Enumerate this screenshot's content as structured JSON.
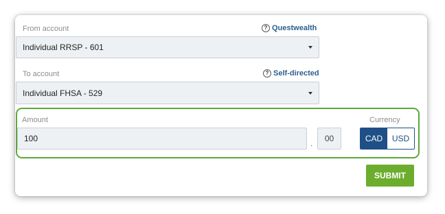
{
  "from_account": {
    "label": "From account",
    "help_text": "Questwealth",
    "help_icon": "question-circle-icon",
    "selected": "Individual RRSP - 601"
  },
  "to_account": {
    "label": "To account",
    "help_text": "Self-directed",
    "help_icon": "question-circle-icon",
    "selected": "Individual FHSA - 529"
  },
  "amount": {
    "label": "Amount",
    "whole_value": "100",
    "decimal_separator": ".",
    "cents_value": "00"
  },
  "currency": {
    "label": "Currency",
    "options": [
      "CAD",
      "USD"
    ],
    "selected": "CAD"
  },
  "submit_label": "SUBMIT",
  "icons": {
    "help": "?"
  },
  "colors": {
    "highlight_border": "#5aa83a",
    "submit_bg": "#6cad2e",
    "currency_active": "#1e4f86",
    "link": "#2b5f8e"
  }
}
